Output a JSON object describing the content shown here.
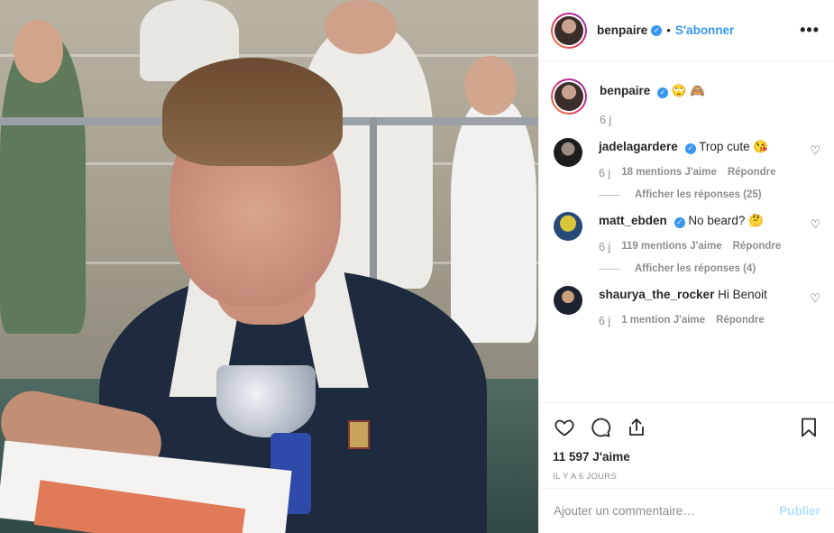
{
  "header": {
    "username": "benpaire",
    "verified_icon": "verified-badge-icon",
    "separator": "•",
    "follow_label": "S'abonner",
    "more_icon": "more-options-icon",
    "more_glyph": "•••"
  },
  "caption": {
    "username": "benpaire",
    "emojis": "🙄 🙈",
    "time": "6 j"
  },
  "comments": [
    {
      "username": "jadelagardere",
      "text": "Trop cute 😘",
      "time": "6 j",
      "likes": "18 mentions J'aime",
      "reply": "Répondre",
      "view_replies": "Afficher les réponses (25)",
      "avatar_color": "#222222"
    },
    {
      "username": "matt_ebden",
      "text": "No beard? 🤔",
      "time": "6 j",
      "likes": "119 mentions J'aime",
      "reply": "Répondre",
      "view_replies": "Afficher les réponses (4)",
      "avatar_color": "#d9c63a"
    },
    {
      "username": "shaurya_the_rocker",
      "text": "Hi Benoit",
      "time": "6 j",
      "likes": "1 mention J'aime",
      "reply": "Répondre",
      "avatar_color": "#1c2230"
    }
  ],
  "actions": {
    "icons": [
      "heart-icon",
      "comment-icon",
      "share-icon",
      "bookmark-icon"
    ],
    "likes_count": "11 597 J'aime",
    "posted": "IL Y A 6 JOURS"
  },
  "add_comment": {
    "placeholder": "Ajouter un commentaire…",
    "publish_label": "Publier"
  },
  "colors": {
    "accent": "#3897f0",
    "publish_disabled": "#b2dffc",
    "muted": "#8e8e8e"
  }
}
